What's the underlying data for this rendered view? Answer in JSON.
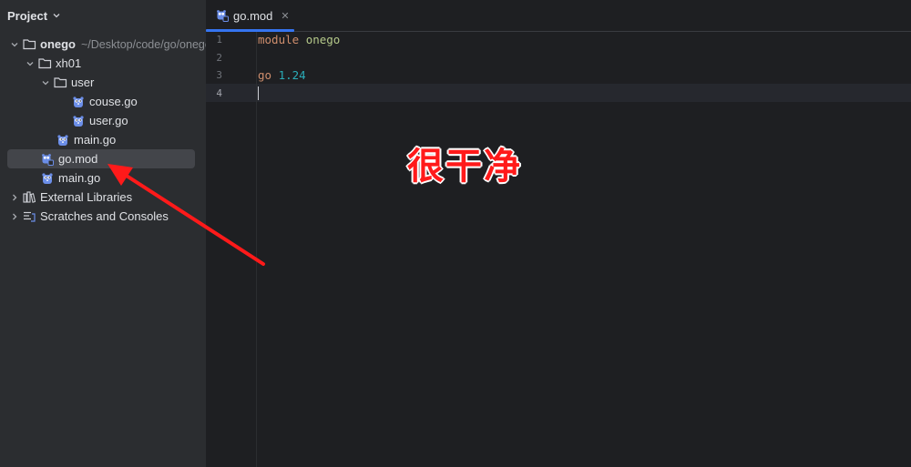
{
  "project_panel": {
    "title": "Project",
    "tree": [
      {
        "label": "onego",
        "path": "~/Desktop/code/go/onego",
        "icon": "folder-icon"
      },
      {
        "label": "xh01",
        "icon": "folder-icon"
      },
      {
        "label": "user",
        "icon": "folder-icon"
      },
      {
        "label": "couse.go",
        "icon": "gopher-icon"
      },
      {
        "label": "user.go",
        "icon": "gopher-icon"
      },
      {
        "label": "main.go",
        "icon": "gopher-icon"
      },
      {
        "label": "go.mod",
        "icon": "gomod-icon",
        "selected": true
      },
      {
        "label": "main.go",
        "icon": "gopher-icon"
      },
      {
        "label": "External Libraries",
        "icon": "library-icon"
      },
      {
        "label": "Scratches and Consoles",
        "icon": "scratches-icon"
      }
    ]
  },
  "editor": {
    "tab": {
      "label": "go.mod",
      "close": "✕"
    },
    "line_numbers": [
      "1",
      "2",
      "3",
      "4"
    ],
    "code": {
      "line1": {
        "keyword": "module",
        "name": "onego"
      },
      "line3": {
        "keyword": "go",
        "version": "1.24"
      }
    }
  },
  "annotation": {
    "text": "很干净"
  },
  "colors": {
    "accent": "#3574f0",
    "annotation": "#ff1a1a",
    "selection": "#43454a",
    "gopher": "#6b8ee8"
  }
}
